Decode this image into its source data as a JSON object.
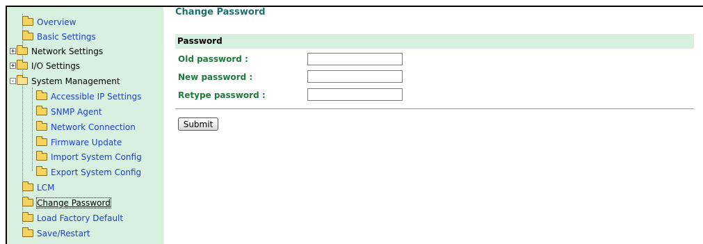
{
  "sidebar": {
    "items": [
      {
        "label": "Overview"
      },
      {
        "label": "Basic Settings"
      },
      {
        "label": "Network Settings",
        "expander": "+"
      },
      {
        "label": "I/O Settings",
        "expander": "+"
      },
      {
        "label": "System Management",
        "expander": "-"
      },
      {
        "label": "Accessible IP Settings"
      },
      {
        "label": "SNMP Agent"
      },
      {
        "label": "Network Connection"
      },
      {
        "label": "Firmware Update"
      },
      {
        "label": "Import System Config"
      },
      {
        "label": "Export System Config"
      },
      {
        "label": "LCM"
      },
      {
        "label": "Change Password"
      },
      {
        "label": "Load Factory Default"
      },
      {
        "label": "Save/Restart"
      }
    ]
  },
  "main": {
    "title": "Change Password",
    "section_title": "Password",
    "fields": [
      {
        "label": "Old password :",
        "value": ""
      },
      {
        "label": "New password :",
        "value": ""
      },
      {
        "label": "Retype password :",
        "value": ""
      }
    ],
    "submit_label": "Submit"
  },
  "colors": {
    "sidebar_bg": "#d8f0e0",
    "link": "#1f3fcc",
    "title": "#1f6e6e",
    "field_label": "#1f7a3c"
  }
}
